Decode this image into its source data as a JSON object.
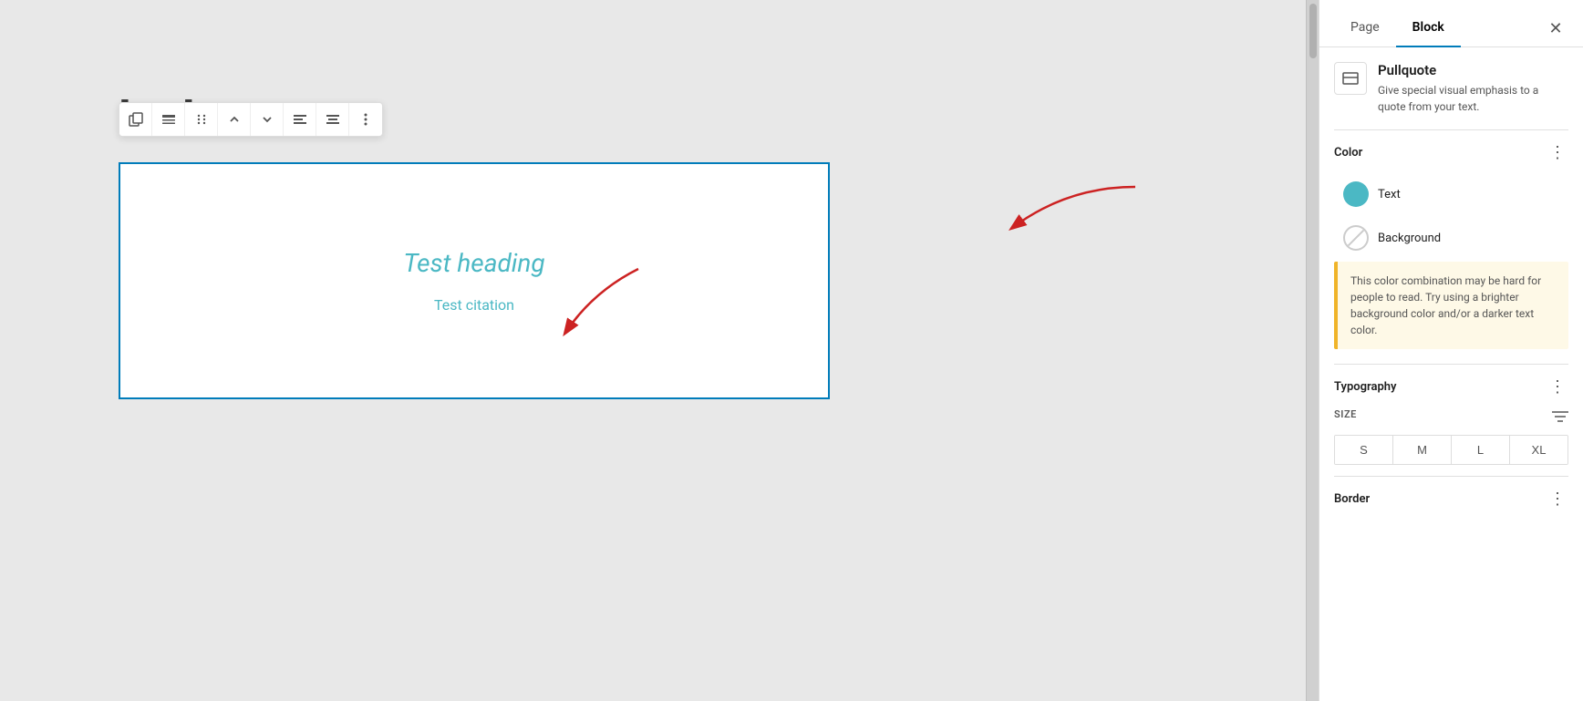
{
  "sidebar": {
    "tabs": [
      {
        "label": "Page",
        "active": false
      },
      {
        "label": "Block",
        "active": true
      }
    ],
    "close_label": "✕",
    "block": {
      "name": "Pullquote",
      "description": "Give special visual emphasis to a quote from your text.",
      "icon": "pullquote-icon"
    },
    "color_section": {
      "title": "Color",
      "options": [
        {
          "label": "Text",
          "type": "filled"
        },
        {
          "label": "Background",
          "type": "empty"
        }
      ]
    },
    "warning": "This color combination may be hard for people to read. Try using a brighter background color and/or a darker text color.",
    "typography": {
      "title": "Typography",
      "size_label": "SIZE",
      "sizes": [
        "S",
        "M",
        "L",
        "XL"
      ]
    },
    "border": {
      "title": "Border"
    }
  },
  "editor": {
    "page_title_partial": "lock",
    "pullquote": {
      "heading": "Test heading",
      "citation": "Test citation"
    }
  },
  "toolbar": {
    "buttons": [
      {
        "icon": "⧉",
        "name": "copy-button"
      },
      {
        "icon": "▬",
        "name": "align-button"
      },
      {
        "icon": "⠿",
        "name": "drag-button"
      },
      {
        "icon": "∧",
        "name": "move-up-button"
      },
      {
        "icon": "∨",
        "name": "move-down-button"
      },
      {
        "icon": "≡",
        "name": "align-left-button"
      },
      {
        "icon": "≡",
        "name": "align-center-button"
      },
      {
        "icon": "⋮",
        "name": "more-options-button"
      }
    ]
  }
}
